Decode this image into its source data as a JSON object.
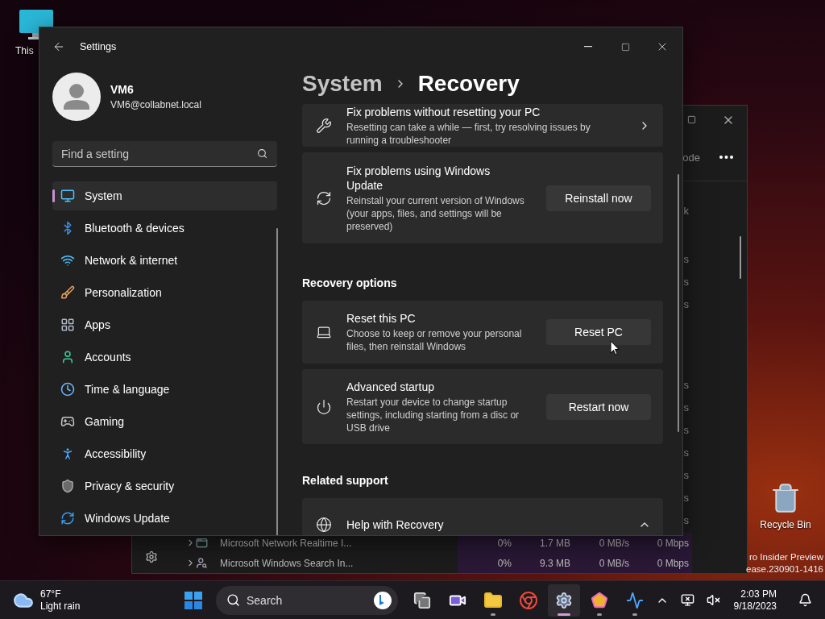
{
  "desktop": {
    "icons": [
      {
        "kind": "computer",
        "label": "This"
      },
      {
        "kind": "recycle-bin",
        "label": "Recycle Bin"
      }
    ],
    "build_info": [
      "ro Insider Preview",
      "ease.230901-1416"
    ]
  },
  "task_manager": {
    "toolbar_fragment": "ode",
    "header_fragment": "k",
    "row_fragments_top": [
      "s",
      "s",
      "s"
    ],
    "row_fragments_bottom": [
      "s",
      "s",
      "s",
      "s",
      "s",
      "s",
      "s"
    ],
    "rows": [
      {
        "name": "Microsoft Network Realtime I...",
        "cpu": "0%",
        "memory": "1.7 MB",
        "disk": "0 MB/s",
        "network": "0 Mbps"
      },
      {
        "name": "Microsoft Windows Search In...",
        "cpu": "0%",
        "memory": "9.3 MB",
        "disk": "0 MB/s",
        "network": "0 Mbps"
      }
    ]
  },
  "settings": {
    "title": "Settings",
    "user": {
      "name": "VM6",
      "email": "VM6@collabnet.local"
    },
    "search": {
      "placeholder": "Find a setting"
    },
    "nav": [
      {
        "label": "System",
        "selected": true
      },
      {
        "label": "Bluetooth & devices",
        "selected": false
      },
      {
        "label": "Network & internet",
        "selected": false
      },
      {
        "label": "Personalization",
        "selected": false
      },
      {
        "label": "Apps",
        "selected": false
      },
      {
        "label": "Accounts",
        "selected": false
      },
      {
        "label": "Time & language",
        "selected": false
      },
      {
        "label": "Gaming",
        "selected": false
      },
      {
        "label": "Accessibility",
        "selected": false
      },
      {
        "label": "Privacy & security",
        "selected": false
      },
      {
        "label": "Windows Update",
        "selected": false
      }
    ],
    "breadcrumb": [
      "System",
      "Recovery"
    ],
    "content": [
      {
        "kind": "link",
        "title": "Fix problems without resetting your PC",
        "description": "Resetting can take a while — first, try resolving issues by running a troubleshooter"
      },
      {
        "kind": "button",
        "title": "Fix problems using Windows Update",
        "description": "Reinstall your current version of Windows (your apps, files, and settings will be preserved)",
        "button": "Reinstall now"
      },
      {
        "kind": "heading",
        "title": "Recovery options"
      },
      {
        "kind": "button",
        "title": "Reset this PC",
        "description": "Choose to keep or remove your personal files, then reinstall Windows",
        "button": "Reset PC"
      },
      {
        "kind": "button",
        "title": "Advanced startup",
        "description": "Restart your device to change startup settings, including starting from a disc or USB drive",
        "button": "Restart now"
      },
      {
        "kind": "heading",
        "title": "Related support"
      },
      {
        "kind": "expander",
        "title": "Help with Recovery",
        "expanded": true
      }
    ]
  },
  "taskbar": {
    "weather": {
      "temperature": "67°F",
      "condition": "Light rain"
    },
    "search": {
      "placeholder": "Search"
    },
    "apps": [
      {
        "kind": "task-view",
        "running": false,
        "selected": false
      },
      {
        "kind": "chat",
        "running": false,
        "selected": false
      },
      {
        "kind": "explorer",
        "running": true,
        "selected": false
      },
      {
        "kind": "browser",
        "running": false,
        "selected": false
      },
      {
        "kind": "settings",
        "running": true,
        "selected": true
      },
      {
        "kind": "shapes",
        "running": true,
        "selected": false
      },
      {
        "kind": "monitor",
        "running": true,
        "selected": false
      }
    ],
    "time": "2:03 PM",
    "date": "9/18/2023"
  }
}
